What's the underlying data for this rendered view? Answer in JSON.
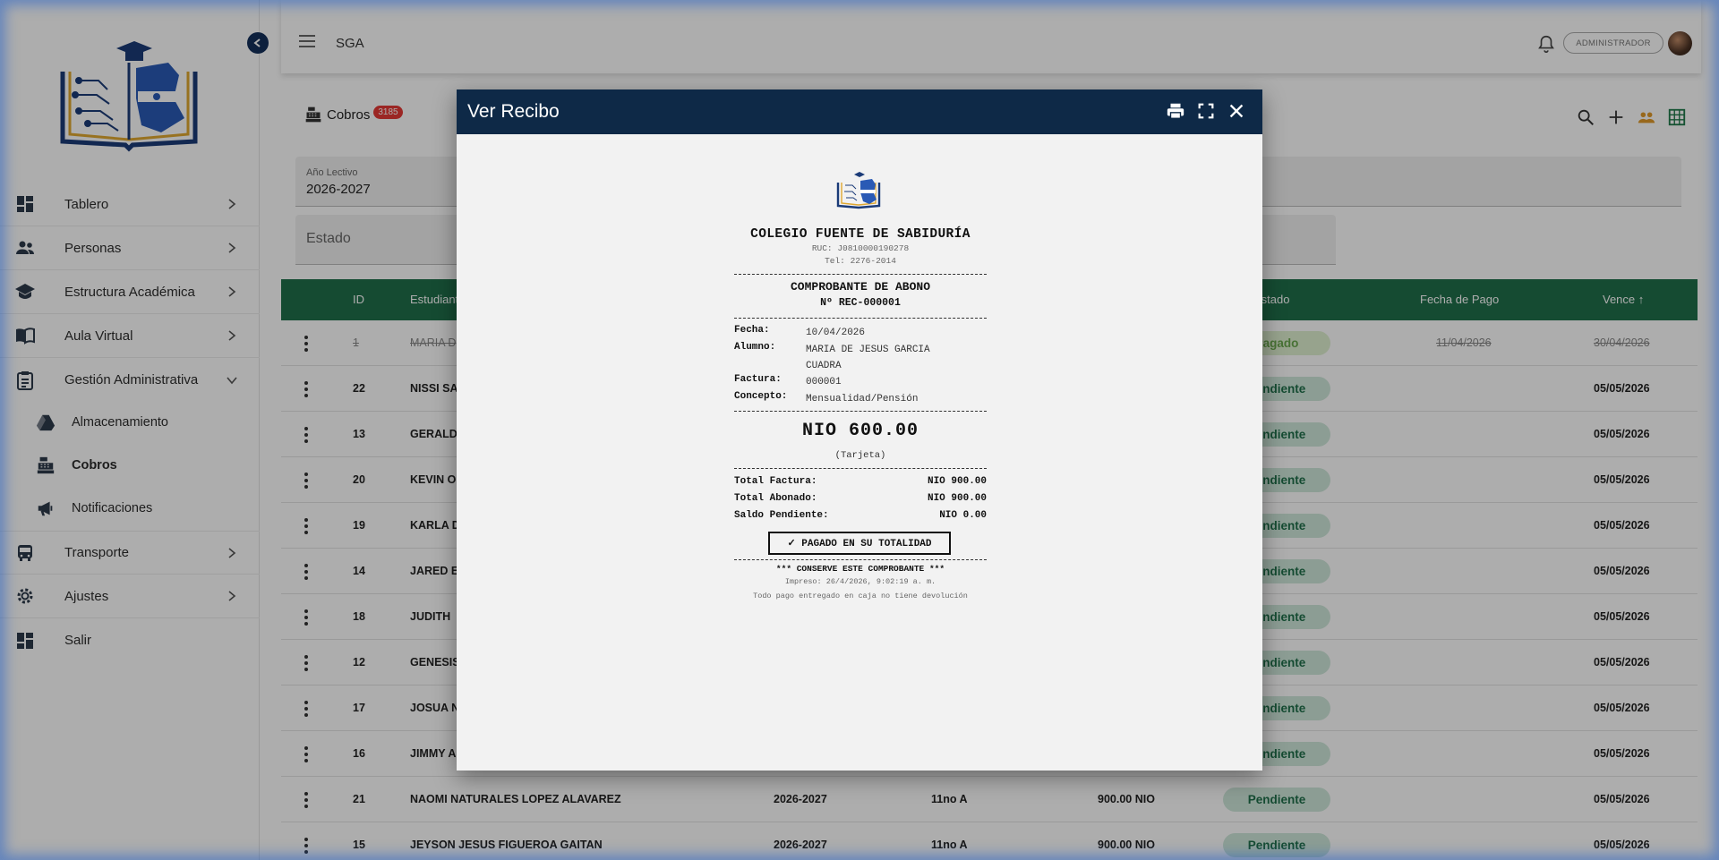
{
  "app": {
    "name": "SGA",
    "role": "ADMINISTRADOR"
  },
  "sidebar": {
    "items": [
      {
        "label": "Tablero",
        "icon": "dashboard-icon"
      },
      {
        "label": "Personas",
        "icon": "people-icon"
      },
      {
        "label": "Estructura Académica",
        "icon": "school-icon"
      },
      {
        "label": "Aula Virtual",
        "icon": "book-icon"
      },
      {
        "label": "Gestión Administrativa",
        "icon": "clipboard-icon"
      },
      {
        "label": "Transporte",
        "icon": "bus-icon"
      },
      {
        "label": "Ajustes",
        "icon": "gear-icon"
      },
      {
        "label": "Salir",
        "icon": "dashboard-icon"
      }
    ],
    "subitems": [
      {
        "label": "Almacenamiento",
        "icon": "drive-icon"
      },
      {
        "label": "Cobros",
        "icon": "cash-register-icon",
        "active": true
      },
      {
        "label": "Notificaciones",
        "icon": "megaphone-icon"
      }
    ]
  },
  "page": {
    "title": "Cobros",
    "count": "3185"
  },
  "filters": {
    "year_label": "Año Lectivo",
    "year_value": "2026-2027",
    "state_label": "Estado"
  },
  "table": {
    "headers": {
      "id": "ID",
      "student": "Estudiante",
      "status": "Estado",
      "paid_date": "Fecha de Pago",
      "due": "Vence"
    },
    "rows": [
      {
        "id": "1",
        "name": "MARIA D",
        "year": "",
        "grade": "",
        "amount": "",
        "status": "Pagado",
        "paid": "11/04/2026",
        "due": "30/04/2026"
      },
      {
        "id": "22",
        "name": "NISSI SA",
        "year": "",
        "grade": "",
        "amount": "",
        "status": "Pendiente",
        "paid": "",
        "due": "05/05/2026"
      },
      {
        "id": "13",
        "name": "GERALD",
        "year": "",
        "grade": "",
        "amount": "",
        "status": "Pendiente",
        "paid": "",
        "due": "05/05/2026"
      },
      {
        "id": "20",
        "name": "KEVIN OI",
        "year": "",
        "grade": "",
        "amount": "",
        "status": "Pendiente",
        "paid": "",
        "due": "05/05/2026"
      },
      {
        "id": "19",
        "name": "KARLA D",
        "year": "",
        "grade": "",
        "amount": "",
        "status": "Pendiente",
        "paid": "",
        "due": "05/05/2026"
      },
      {
        "id": "14",
        "name": "JARED E",
        "year": "",
        "grade": "",
        "amount": "",
        "status": "Pendiente",
        "paid": "",
        "due": "05/05/2026"
      },
      {
        "id": "18",
        "name": "JUDITH",
        "year": "",
        "grade": "",
        "amount": "",
        "status": "Pendiente",
        "paid": "",
        "due": "05/05/2026"
      },
      {
        "id": "12",
        "name": "GENESIS",
        "year": "",
        "grade": "",
        "amount": "",
        "status": "Pendiente",
        "paid": "",
        "due": "05/05/2026"
      },
      {
        "id": "17",
        "name": "JOSUA N",
        "year": "",
        "grade": "",
        "amount": "",
        "status": "Pendiente",
        "paid": "",
        "due": "05/05/2026"
      },
      {
        "id": "16",
        "name": "JIMMY A",
        "year": "",
        "grade": "",
        "amount": "",
        "status": "Pendiente",
        "paid": "",
        "due": "05/05/2026"
      },
      {
        "id": "21",
        "name": "NAOMI NATURALES LOPEZ ALAVAREZ",
        "year": "2026-2027",
        "grade": "11no A",
        "amount": "900.00 NIO",
        "status": "Pendiente",
        "paid": "",
        "due": "05/05/2026"
      },
      {
        "id": "15",
        "name": "JEYSON JESUS FIGUEROA GAITAN",
        "year": "2026-2027",
        "grade": "11no A",
        "amount": "900.00 NIO",
        "status": "Pendiente",
        "paid": "",
        "due": "05/05/2026"
      }
    ]
  },
  "modal": {
    "title": "Ver Recibo"
  },
  "receipt": {
    "school": "COLEGIO FUENTE DE SABIDURÍA",
    "ruc": "RUC: J0810000190278",
    "tel": "Tel: 2276-2014",
    "doc_type": "COMPROBANTE DE ABONO",
    "number": "Nº REC-000001",
    "fields": [
      {
        "key": "Fecha:",
        "value": "10/04/2026"
      },
      {
        "key": "Alumno:",
        "value": "MARIA DE JESUS GARCIA CUADRA"
      },
      {
        "key": "Factura:",
        "value": "000001"
      },
      {
        "key": "Concepto:",
        "value": "Mensualidad/Pensión"
      }
    ],
    "amount": "NIO 600.00",
    "method": "(Tarjeta)",
    "totals": [
      {
        "key": "Total Factura:",
        "value": "NIO 900.00"
      },
      {
        "key": "Total Abonado:",
        "value": "NIO 900.00"
      },
      {
        "key": "Saldo Pendiente:",
        "value": "NIO 0.00"
      }
    ],
    "paid_stamp": "✓ PAGADO EN SU TOTALIDAD",
    "keep_note": "*** CONSERVE ESTE COMPROBANTE ***",
    "printed": "Impreso: 26/4/2026, 9:02:19 a. m.",
    "no_refund": "Todo pago entregado en caja no tiene devolución"
  },
  "colors": {
    "navy": "#0e2947",
    "table_header": "#1f6f4a",
    "badge_red": "#e53935",
    "pending_bg": "#cfe8db"
  }
}
